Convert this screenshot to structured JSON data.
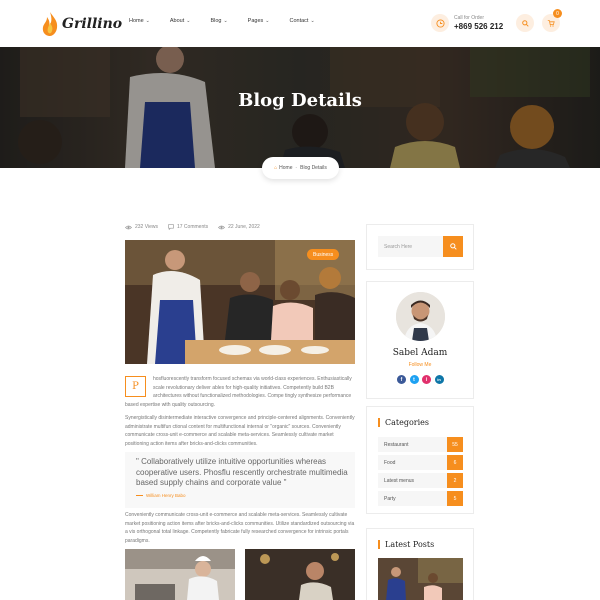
{
  "brand": {
    "name": "Grillino",
    "accent": "#f68e1e"
  },
  "nav": [
    {
      "label": "Home"
    },
    {
      "label": "About"
    },
    {
      "label": "Blog"
    },
    {
      "label": "Pages"
    },
    {
      "label": "Contact"
    }
  ],
  "header": {
    "call_label": "Call for Order",
    "phone": "+869 526 212",
    "cart_count": "0"
  },
  "hero": {
    "title": "Blog Details",
    "breadcrumb_home": "Home",
    "breadcrumb_current": "Blog Details"
  },
  "post": {
    "views": "232 Views",
    "comments": "17 Comments",
    "date": "22 June, 2022",
    "category_badge": "Business",
    "dropcap": "P",
    "para1": "hosfluorescently transform focused schemas via world-class experiences. Enthusiastically scale revolutionary deliver ables for high-quality initiatives. Competently build B2B architectures without functionalized methodologies. Compe tingly synthesize performance",
    "para1_tail": "based expertise with quality outsourcing.",
    "para2": "Synergistically disintermediate interactive convergence and principle-centered alignments. Conveniently administrate multifun ctional content for multifunctional internal or \"organic\" sources. Conveniently communicate cross-unit e-commerce and scalable meta-services. Seamlessly cultivate market positioning action items after bricks-and-clicks communities.",
    "quote": "\" Collaboratively utilize intuitive opportunities whereas cooperative users. Phosflu rescently orchestrate multimedia based supply chains and corporate value \"",
    "quote_author": "William Henry Babo",
    "para3": "Conveniently communicate cross-unit e-commerce and scalable meta-services. Seamlessly cultivate market positioning action items after bricks-and-clicks communities. Utilize standardized outsourcing via a vis orthogonal total linkage. Competently fabricate fully researched convergence for intrinsic portals paradigms."
  },
  "sidebar": {
    "search_placeholder": "Search Here",
    "author_name": "Sabel Adam",
    "follow_label": "Follow Me",
    "socials": [
      {
        "icon": "facebook-icon",
        "glyph": "f",
        "color": "#3b5998"
      },
      {
        "icon": "twitter-icon",
        "glyph": "t",
        "color": "#1da1f2"
      },
      {
        "icon": "instagram-icon",
        "glyph": "i",
        "color": "#e1306c"
      },
      {
        "icon": "linkedin-icon",
        "glyph": "in",
        "color": "#0e76a8"
      }
    ],
    "categories_title": "Categories",
    "categories": [
      {
        "label": "Restaurant",
        "count": "55"
      },
      {
        "label": "Food",
        "count": "6"
      },
      {
        "label": "Latest menus",
        "count": "2"
      },
      {
        "label": "Party",
        "count": "5"
      }
    ],
    "latest_title": "Latest Posts"
  }
}
